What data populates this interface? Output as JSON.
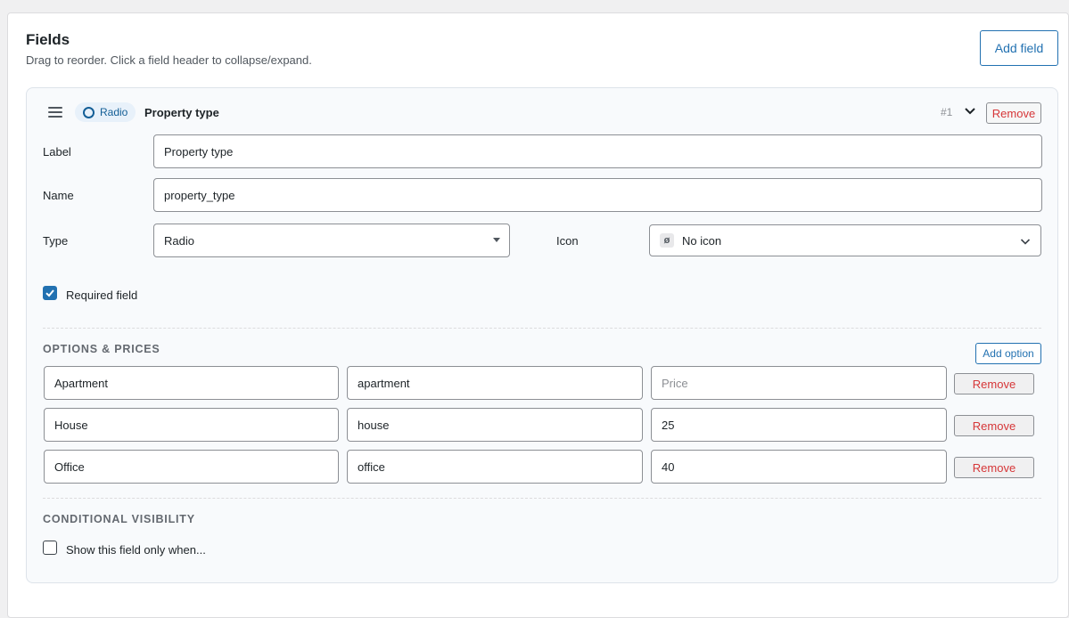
{
  "header": {
    "title": "Fields",
    "subtitle": "Drag to reorder. Click a field header to collapse/expand.",
    "add_field_label": "Add field"
  },
  "field": {
    "type_badge": "Radio",
    "title": "Property type",
    "index": "#1",
    "remove_label": "Remove",
    "label_caption": "Label",
    "label_value": "Property type",
    "name_caption": "Name",
    "name_value": "property_type",
    "type_caption": "Type",
    "type_value": "Radio",
    "icon_caption": "Icon",
    "icon_badge": "ø",
    "icon_value": "No icon",
    "required_label": "Required field",
    "required_checked": true
  },
  "options": {
    "section_title": "OPTIONS & PRICES",
    "add_option_label": "Add option",
    "price_placeholder": "Price",
    "remove_label": "Remove",
    "rows": [
      {
        "label": "Apartment",
        "value": "apartment",
        "price": ""
      },
      {
        "label": "House",
        "value": "house",
        "price": "25"
      },
      {
        "label": "Office",
        "value": "office",
        "price": "40"
      }
    ]
  },
  "conditional": {
    "section_title": "CONDITIONAL VISIBILITY",
    "checkbox_label": "Show this field only when...",
    "checked": false
  },
  "colors": {
    "accent": "#2271b1",
    "danger": "#d63638",
    "card_bg": "#f8fafc"
  }
}
